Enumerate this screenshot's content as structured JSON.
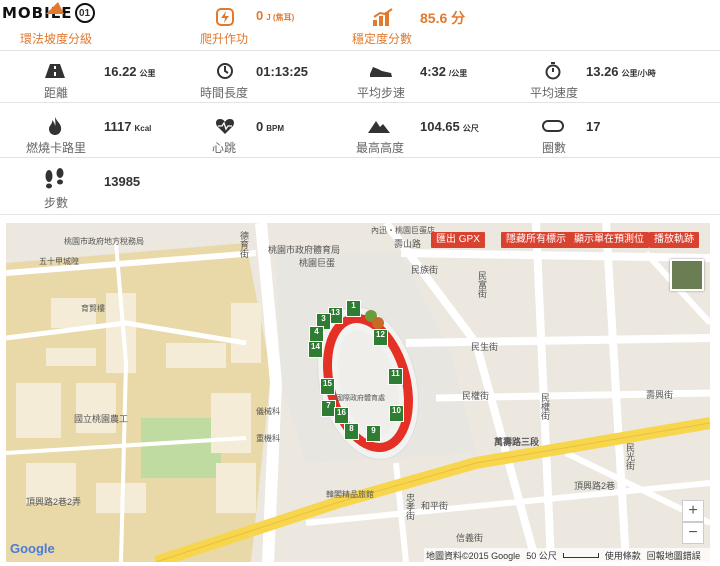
{
  "logo": {
    "text": "MOBILE",
    "badge": "01"
  },
  "top_stats": [
    {
      "label": "環法坡度分級",
      "value": "",
      "unit": "",
      "icon": "mountain-grade-icon"
    },
    {
      "label": "爬升作功",
      "value": "0",
      "unit": "J (焦耳)",
      "icon": "power-bolt-icon"
    },
    {
      "label": "穩定度分數",
      "value": "85.6 分",
      "unit": "",
      "icon": "bar-chart-icon"
    }
  ],
  "stats_row1": [
    {
      "label": "距離",
      "value": "16.22",
      "unit": "公里",
      "icon": "road-icon"
    },
    {
      "label": "時間長度",
      "value": "01:13:25",
      "unit": "",
      "icon": "clock-icon"
    },
    {
      "label": "平均步速",
      "value": "4:32",
      "unit": "/公里",
      "icon": "shoe-icon"
    },
    {
      "label": "平均速度",
      "value": "13.26",
      "unit": "公里/小時",
      "icon": "stopwatch-icon"
    }
  ],
  "stats_row2": [
    {
      "label": "燃燒卡路里",
      "value": "1117",
      "unit": "Kcal",
      "icon": "flame-icon"
    },
    {
      "label": "心跳",
      "value": "0",
      "unit": "BPM",
      "icon": "heart-icon"
    },
    {
      "label": "最高高度",
      "value": "104.65",
      "unit": "公尺",
      "icon": "mountain-icon"
    },
    {
      "label": "圈數",
      "value": "17",
      "unit": "",
      "icon": "lap-icon"
    }
  ],
  "stats_row3": [
    {
      "label": "步數",
      "value": "13985",
      "unit": "",
      "icon": "footsteps-icon"
    }
  ],
  "map": {
    "buttons": [
      "匯出 GPX",
      "隱藏所有標示",
      "顯示單在預測位",
      "播放軌跡"
    ],
    "places": [
      "桃園市政府體育局",
      "桃園巨蛋",
      "國立桃園農工",
      "國際政府體育處",
      "五十甲城隍",
      "育賢樓",
      "儀械科",
      "重機科",
      "桃園市政府地方稅務局",
      "韓閣精品旅館",
      "內迅・桃園巨蛋店"
    ],
    "streets": [
      "壽山路",
      "民族街",
      "民富街",
      "民生街",
      "民權街",
      "萬壽路三段",
      "頂興路2巷",
      "頂興路2巷2弄",
      "信義街",
      "和平街",
      "忠孝街",
      "德育街",
      "壽興街",
      "民權街",
      "民光街"
    ],
    "km_markers": [
      "1",
      "13",
      "3",
      "4",
      "14",
      "12",
      "11",
      "15",
      "7",
      "16",
      "10",
      "8",
      "9"
    ],
    "zoom_in": "+",
    "zoom_out": "−",
    "google": "Google",
    "attribution": "地圖資料©2015 Google",
    "scale": "50 公尺",
    "terms": "使用條款",
    "report": "回報地圖錯誤"
  }
}
